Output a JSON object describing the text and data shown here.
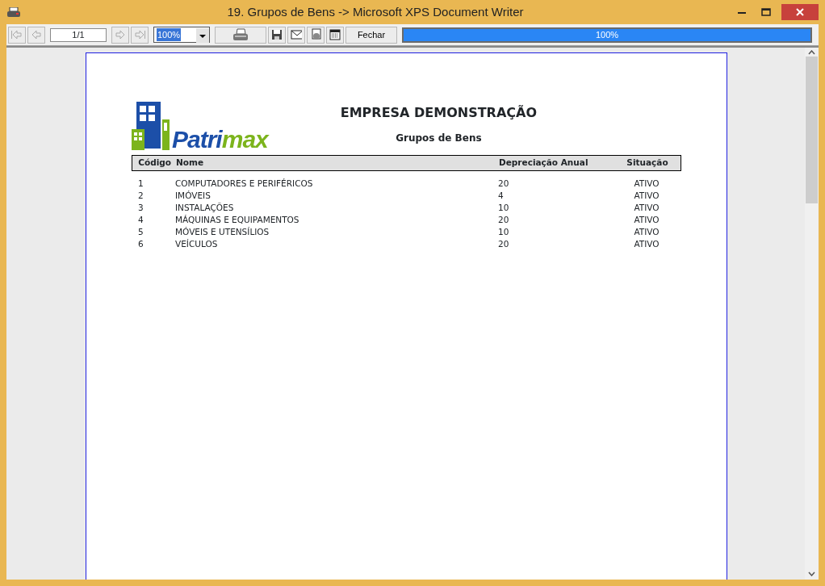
{
  "window": {
    "title": "19. Grupos de Bens -> Microsoft XPS Document Writer"
  },
  "toolbar": {
    "page_field": "1/1",
    "zoom": "100%",
    "close_button": "Fechar",
    "progress": {
      "level": 1,
      "reading": "100%"
    }
  },
  "report": {
    "logo": [
      {
        "text": "Patri",
        "color": "#1c4fa8"
      },
      {
        "text": "max",
        "color": "#7cb41c"
      }
    ],
    "company": "EMPRESA DEMONSTRAÇÃO",
    "title": "Grupos de Bens",
    "columns": [
      "Código",
      "Nome",
      "Depreciação Anual",
      "Situação"
    ],
    "rows": [
      {
        "code": "1",
        "name": "COMPUTADORES E PERIFÉRICOS",
        "rate": "20",
        "status": "ATIVO"
      },
      {
        "code": "2",
        "name": "IMÓVEIS",
        "rate": "4",
        "status": "ATIVO"
      },
      {
        "code": "3",
        "name": "INSTALAÇÕES",
        "rate": "10",
        "status": "ATIVO"
      },
      {
        "code": "4",
        "name": "MÁQUINAS E EQUIPAMENTOS",
        "rate": "20",
        "status": "ATIVO"
      },
      {
        "code": "5",
        "name": "MÓVEIS E UTENSÍLIOS",
        "rate": "10",
        "status": "ATIVO"
      },
      {
        "code": "6",
        "name": "VEÍCULOS",
        "rate": "20",
        "status": "ATIVO"
      }
    ]
  }
}
